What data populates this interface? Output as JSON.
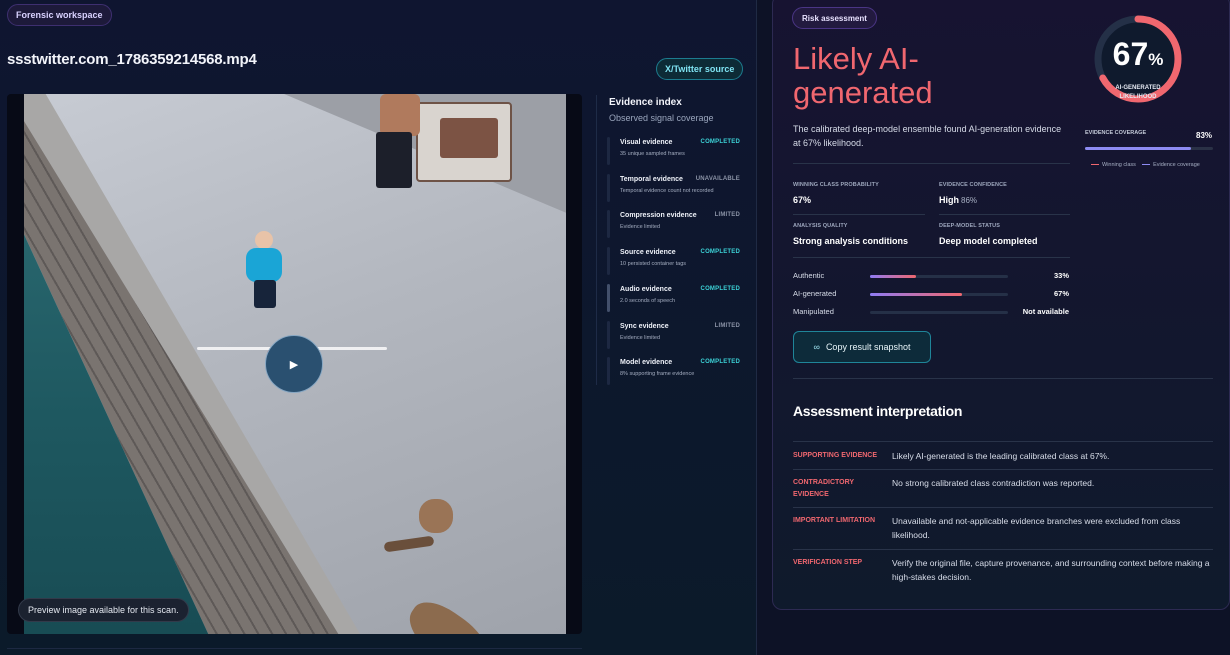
{
  "workspace": {
    "badge": "Forensic workspace",
    "file_name": "ssstwitter.com_1786359214568.mp4",
    "source_badge": "X/Twitter source",
    "preview_note": "Preview image available for this scan."
  },
  "player": {
    "progress": 0,
    "play_icon": "play-icon"
  },
  "evidence_index": {
    "title": "Evidence index",
    "subtitle": "Observed signal coverage",
    "items": [
      {
        "name": "Visual evidence",
        "status": "COMPLETED",
        "status_type": "completed",
        "desc": "35 unique sampled frames"
      },
      {
        "name": "Temporal evidence",
        "status": "UNAVAILABLE",
        "status_type": "unavailable",
        "desc": "Temporal evidence count not recorded"
      },
      {
        "name": "Compression evidence",
        "status": "LIMITED",
        "status_type": "limited",
        "desc": "Evidence limited"
      },
      {
        "name": "Source evidence",
        "status": "COMPLETED",
        "status_type": "completed",
        "desc": "10 persisted container tags"
      },
      {
        "name": "Audio evidence",
        "status": "COMPLETED",
        "status_type": "completed",
        "desc": "2.0 seconds of speech"
      },
      {
        "name": "Sync evidence",
        "status": "LIMITED",
        "status_type": "limited",
        "desc": "Evidence limited"
      },
      {
        "name": "Model evidence",
        "status": "COMPLETED",
        "status_type": "completed",
        "desc": "8% supporting frame evidence"
      }
    ]
  },
  "risk": {
    "badge": "Risk assessment",
    "verdict": "Likely AI-generated",
    "description": "The calibrated deep-model ensemble found AI-generation evidence at 67% likelihood.",
    "gauge": {
      "value": "67",
      "unit": "%",
      "label_line1": "AI-GENERATED",
      "label_line2": "LIKELIHOOD",
      "fraction": 0.67
    },
    "coverage": {
      "label": "EVIDENCE COVERAGE",
      "value": "83%",
      "fraction": 0.83
    },
    "legend": {
      "winning": "Winning class",
      "coverage": "Evidence coverage"
    },
    "stats": {
      "winning_label": "WINNING CLASS PROBABILITY",
      "winning_value": "67%",
      "confidence_label": "EVIDENCE CONFIDENCE",
      "confidence_value": "High",
      "confidence_pct": "86%",
      "quality_label": "ANALYSIS QUALITY",
      "quality_value": "Strong analysis conditions",
      "model_label": "DEEP-MODEL STATUS",
      "model_value": "Deep model completed"
    },
    "bars": [
      {
        "label": "Authentic",
        "value": "33%",
        "fraction": 0.33
      },
      {
        "label": "AI-generated",
        "value": "67%",
        "fraction": 0.67
      },
      {
        "label": "Manipulated",
        "value": "Not available",
        "fraction": 0
      }
    ],
    "copy_button": "Copy result snapshot"
  },
  "interpretation": {
    "title": "Assessment interpretation",
    "rows": [
      {
        "key": "SUPPORTING EVIDENCE",
        "text": "Likely AI-generated is the leading calibrated class at 67%."
      },
      {
        "key": "CONTRADICTORY EVIDENCE",
        "text": "No strong calibrated class contradiction was reported."
      },
      {
        "key": "IMPORTANT LIMITATION",
        "text": "Unavailable and not-applicable evidence branches were excluded from class likelihood."
      },
      {
        "key": "VERIFICATION STEP",
        "text": "Verify the original file, capture provenance, and surrounding context before making a high-stakes decision."
      }
    ]
  },
  "colors": {
    "accent_red": "#f0676f",
    "accent_violet": "#8d8bf2",
    "accent_cyan": "#3cd3d8"
  }
}
